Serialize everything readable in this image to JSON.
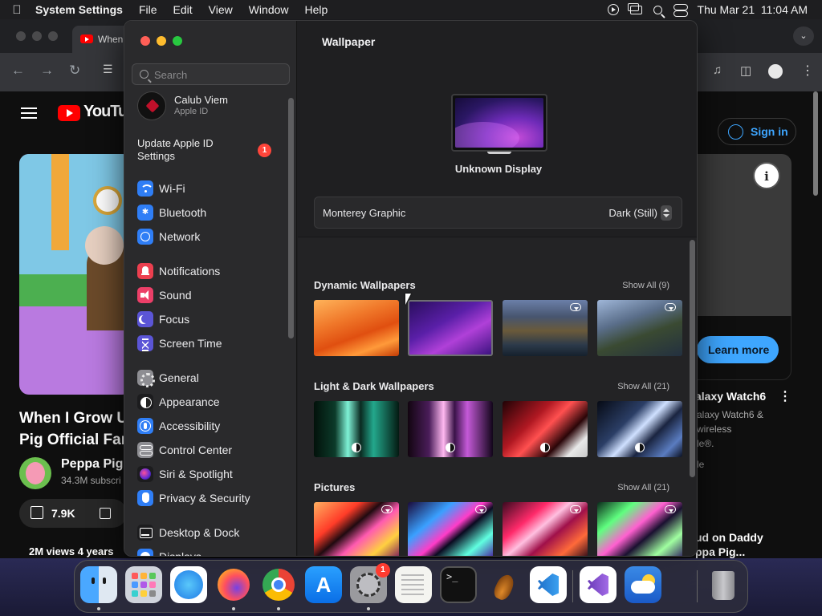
{
  "menubar": {
    "app_name": "System Settings",
    "items": [
      "File",
      "Edit",
      "View",
      "Window",
      "Help"
    ],
    "datetime": "Thu Mar 21  11:04 AM"
  },
  "browser": {
    "tab_title": "When",
    "youtube_word": "YouTube",
    "sign_in_label": "Sign in",
    "video_title_line1": "When I Grow U",
    "video_title_line2": "Pig Official Far",
    "channel_name": "Peppa Pig",
    "channel_subs": "34.3M subscri",
    "like_count": "7.9K",
    "views_row": "2M views  4 years",
    "ad": {
      "learn_more_label": "Learn more",
      "title": "alaxy Watch6",
      "line1": "alaxy Watch6 &",
      "line2": "wireless",
      "line3": "le®.",
      "line4": "le"
    },
    "next_video_line1": "ud on Daddy",
    "next_video_line2": "ppa Pig..."
  },
  "settings": {
    "search_placeholder": "Search",
    "account": {
      "name": "Calub Viem",
      "subtitle": "Apple ID"
    },
    "update": {
      "label": "Update Apple ID Settings",
      "badge": "1"
    },
    "nav_groups": [
      [
        {
          "label": "Wi-Fi",
          "icon": "wifi-icon",
          "color": "#2f7ef6"
        },
        {
          "label": "Bluetooth",
          "icon": "bluetooth-icon",
          "color": "#2f7ef6"
        },
        {
          "label": "Network",
          "icon": "globe-icon",
          "color": "#2f7ef6"
        }
      ],
      [
        {
          "label": "Notifications",
          "icon": "bell-icon",
          "color": "#ec3f4f"
        },
        {
          "label": "Sound",
          "icon": "speaker-icon",
          "color": "#ec3f68"
        },
        {
          "label": "Focus",
          "icon": "moon-icon",
          "color": "#5b55d6"
        },
        {
          "label": "Screen Time",
          "icon": "hourglass-icon",
          "color": "#5b55d6"
        }
      ],
      [
        {
          "label": "General",
          "icon": "gear-icon",
          "color": "#8e8e93"
        },
        {
          "label": "Appearance",
          "icon": "appearance-icon",
          "color": "#1c1c1e"
        },
        {
          "label": "Accessibility",
          "icon": "accessibility-icon",
          "color": "#2f7ef6"
        },
        {
          "label": "Control Center",
          "icon": "control-center-icon",
          "color": "#8e8e93"
        },
        {
          "label": "Siri & Spotlight",
          "icon": "siri-icon",
          "color": "#1c1c1e"
        },
        {
          "label": "Privacy & Security",
          "icon": "hand-icon",
          "color": "#2f7ef6"
        }
      ],
      [
        {
          "label": "Desktop & Dock",
          "icon": "dock-icon",
          "color": "#1c1c1e"
        },
        {
          "label": "Displays",
          "icon": "displays-icon",
          "color": "#2f7ef6"
        }
      ]
    ],
    "main": {
      "title": "Wallpaper",
      "display_name": "Unknown Display",
      "wallpaper_name": "Monterey Graphic",
      "wallpaper_mode": "Dark (Still)",
      "sections": [
        {
          "title": "Dynamic Wallpapers",
          "show_all": "Show All (9)"
        },
        {
          "title": "Light & Dark Wallpapers",
          "show_all": "Show All (21)"
        },
        {
          "title": "Pictures",
          "show_all": "Show All (21)"
        }
      ]
    }
  },
  "dock": {
    "apps": [
      {
        "name": "finder",
        "running": true
      },
      {
        "name": "launchpad",
        "running": false
      },
      {
        "name": "safari",
        "running": false
      },
      {
        "name": "firefox",
        "running": true
      },
      {
        "name": "chrome",
        "running": true
      },
      {
        "name": "app-store",
        "running": false
      },
      {
        "name": "system-settings",
        "running": true,
        "badge": "1"
      },
      {
        "name": "textedit",
        "running": false
      },
      {
        "name": "terminal",
        "running": false
      },
      {
        "name": "garageband",
        "running": false
      },
      {
        "name": "vscode",
        "running": false
      },
      {
        "name": "visual-studio",
        "running": false
      },
      {
        "name": "weather",
        "running": false
      },
      {
        "name": "trash",
        "running": false
      }
    ]
  }
}
